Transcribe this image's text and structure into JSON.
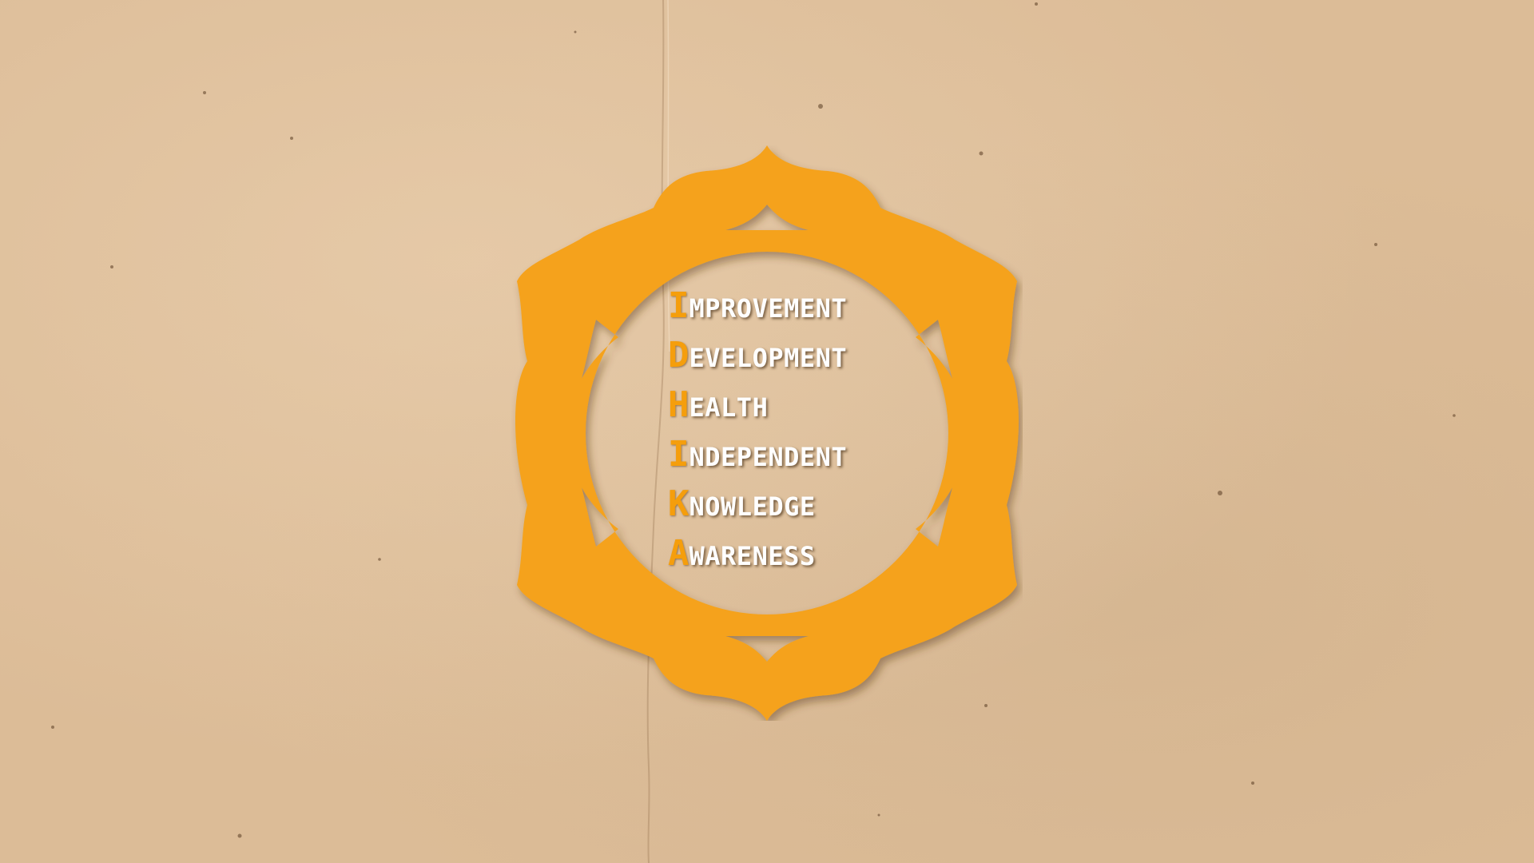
{
  "background": {
    "color": "#dcbc97",
    "texture": "aged-paper"
  },
  "emblem": {
    "shape": "lotus-ring-icon",
    "color": "#f5a21a"
  },
  "acronym": {
    "word": "IDHIKA",
    "initial_color": "#f59e0c",
    "rest_color": "#ffffff",
    "rows": [
      {
        "initial": "I",
        "rest": "MPROVEMENT"
      },
      {
        "initial": "D",
        "rest": "EVELOPMENT"
      },
      {
        "initial": "H",
        "rest": "EALTH"
      },
      {
        "initial": "I",
        "rest": "NDEPENDENT"
      },
      {
        "initial": "K",
        "rest": "NOWLEDGE"
      },
      {
        "initial": "A",
        "rest": "WARENESS"
      }
    ]
  }
}
